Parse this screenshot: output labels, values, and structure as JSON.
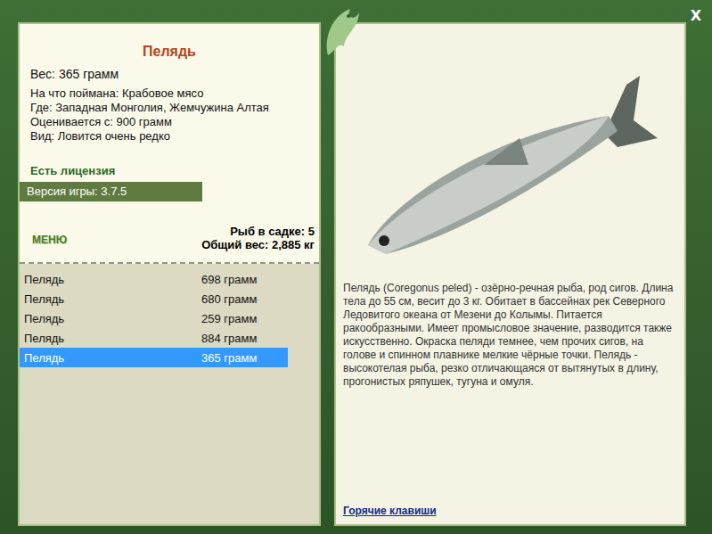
{
  "window": {
    "close": "X"
  },
  "fish": {
    "title": "Пелядь",
    "weight": "Вес: 365 грамм",
    "details": [
      "На что поймана: Крабовое мясо",
      "Где: Западная Монголия, Жемчужина Алтая",
      "Оценивается с: 900 грамм",
      "Вид: Ловится очень редко"
    ]
  },
  "license": "Есть лицензия",
  "version": "Версия игры: 3.7.5",
  "menu": "МЕНЮ",
  "keepnet": {
    "count": "Рыб в садке: 5",
    "total": "Общий вес: 2,885 кг"
  },
  "catches": [
    {
      "name": "Пелядь",
      "weight": "698 грамм",
      "selected": false
    },
    {
      "name": "Пелядь",
      "weight": "680 грамм",
      "selected": false
    },
    {
      "name": "Пелядь",
      "weight": "259 грамм",
      "selected": false
    },
    {
      "name": "Пелядь",
      "weight": "884 грамм",
      "selected": false
    },
    {
      "name": "Пелядь",
      "weight": "365 грамм",
      "selected": true
    }
  ],
  "description": "Пелядь (Coregonus peled) - озёрно-речная рыба, род сигов. Длина тела до 55 см, весит до 3 кг. Обитает в бассейнах рек Северного Ледовитого океана от Мезени до Колымы. Питается ракообразными. Имеет промысловое значение, разводится также искусственно. Окраска пеляди темнее, чем прочих сигов, на голове и спинном плавнике мелкие чёрные точки. Пелядь - высокотелая рыба, резко отличающаяся от вытянутых в длину, прогонистых ряпушек, тугуна и омуля.",
  "hotkeys": "Горячие клавиши"
}
